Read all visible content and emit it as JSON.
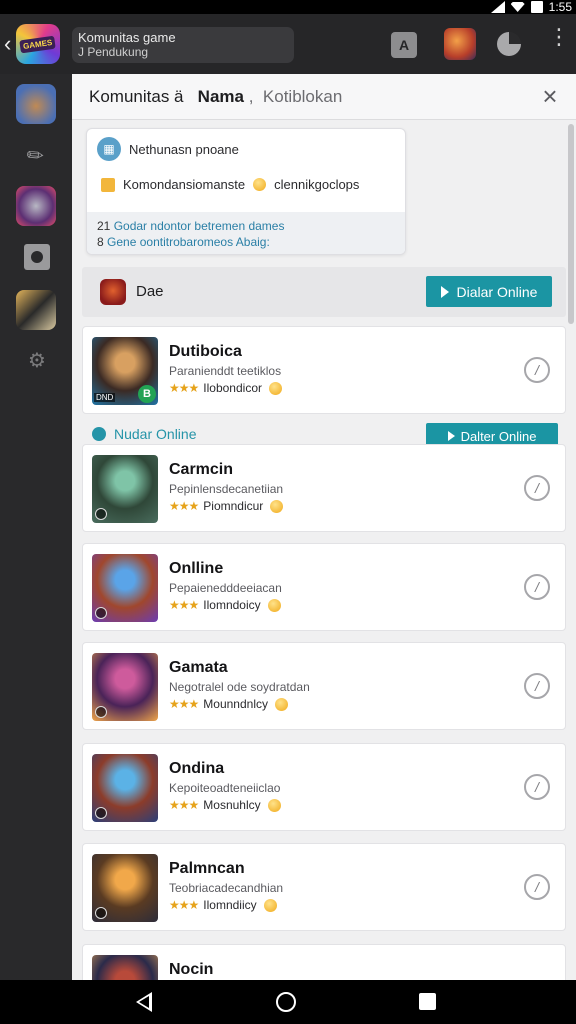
{
  "status": {
    "time": "1:55"
  },
  "appbar": {
    "title_line1": "Komunitas game",
    "title_line2": "J Pendukung",
    "logo_text": "GAMES",
    "a_icon_label": "A"
  },
  "search": {
    "prefix": "Komunitas ä",
    "bold_term": "Nama",
    "suffix": "Kotiblokan",
    "close_glyph": "×"
  },
  "suggest": {
    "line1": "Nethunasn pnoane",
    "line2_a": "Komondansiomanste",
    "line2_b": "clennikgoclops",
    "foot_line1_k": "21",
    "foot_line1": "Godar ndontor betremen dames",
    "foot_line2_k": "8",
    "foot_line2": "Gene oontitrobaromeos Abaig:"
  },
  "featured": {
    "label": "Dae",
    "button": "Dialar Online"
  },
  "section": {
    "label": "Nudar Online",
    "button": "Dalter Online"
  },
  "games": [
    {
      "title": "Dutiboica",
      "subtitle": "Paranienddt teetiklos",
      "rating_text": "Ilobondicor",
      "thumb_colors": [
        "#d8a061",
        "#3b2a24",
        "#1f74a6"
      ],
      "badge": "B",
      "tag": "DND"
    },
    {
      "title": "Carmcin",
      "subtitle": "Pepinlensdecanetiian",
      "rating_text": "Piomndicur",
      "thumb_colors": [
        "#7fc4a7",
        "#2f4738",
        "#4a6d5e"
      ]
    },
    {
      "title": "Onlline",
      "subtitle": "Pepaienedddeeiacan",
      "rating_text": "Ilomndoicy",
      "thumb_colors": [
        "#5aa4e8",
        "#a0472d",
        "#6b3cb4"
      ]
    },
    {
      "title": "Gamata",
      "subtitle": "Negotralel ode soydratdan",
      "rating_text": "Mounndnlcy",
      "thumb_colors": [
        "#ce5b9c",
        "#4a2358",
        "#f0a64a"
      ]
    },
    {
      "title": "Ondina",
      "subtitle": "Kepoiteoadteneiiclao",
      "rating_text": "Mosnuhlcy",
      "thumb_colors": [
        "#5bb2e6",
        "#8c3c2a",
        "#2a3f7a"
      ]
    },
    {
      "title": "Palmncan",
      "subtitle": "Teobriacadecandhian",
      "rating_text": "Ilomndiicy",
      "thumb_colors": [
        "#f1a84a",
        "#5a3b22",
        "#2c2c3a"
      ]
    },
    {
      "title": "Nocin",
      "subtitle": "",
      "rating_text": "",
      "thumb_colors": [
        "#b84a3a",
        "#2a2a4a",
        "#e0a25a"
      ]
    }
  ],
  "rating_stars": "★★★"
}
